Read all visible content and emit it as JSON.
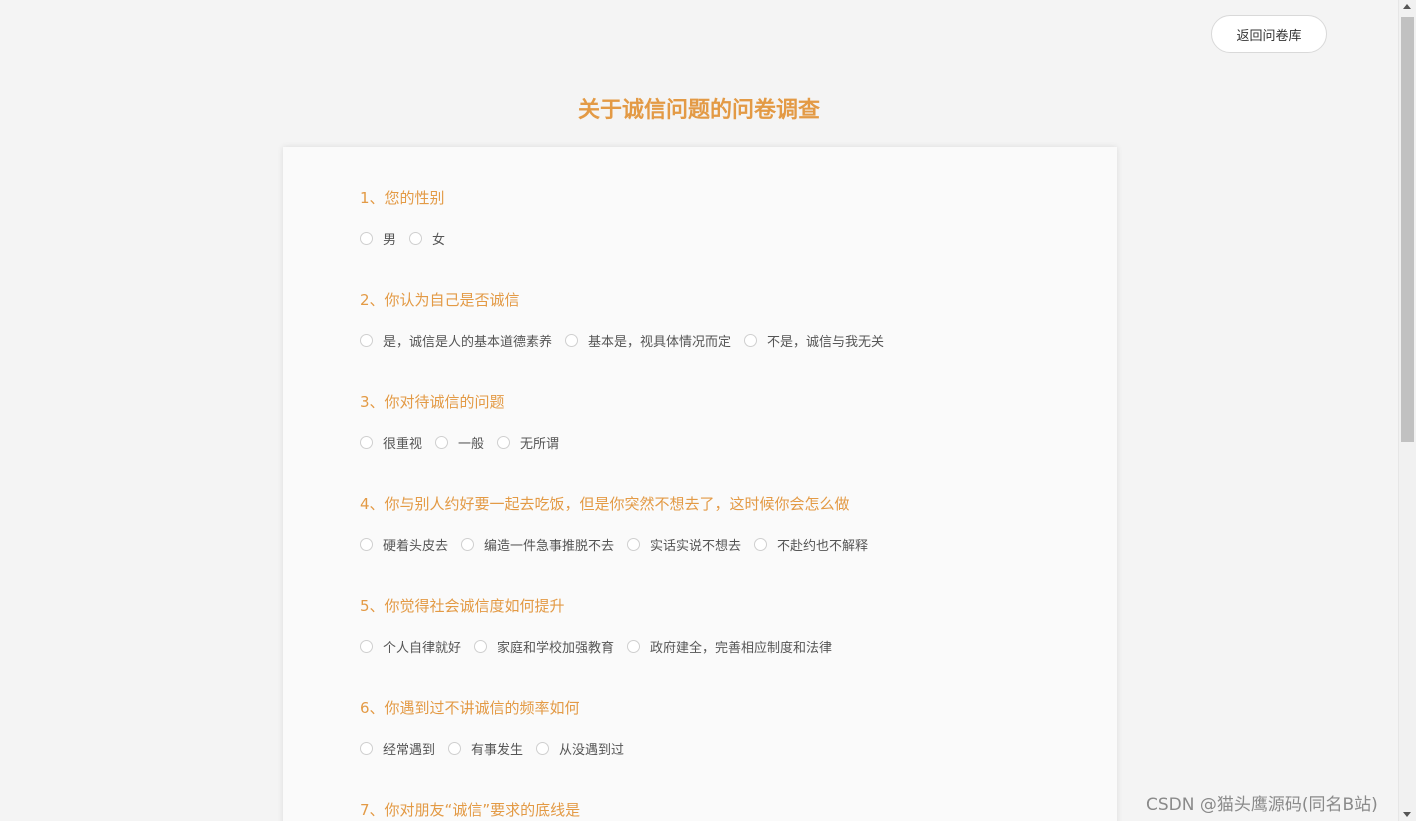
{
  "header": {
    "back_button_label": "返回问卷库"
  },
  "survey": {
    "title": "关于诚信问题的问卷调查",
    "questions": [
      {
        "title": "1、您的性别",
        "options": [
          "男",
          "女"
        ]
      },
      {
        "title": "2、你认为自己是否诚信",
        "options": [
          "是，诚信是人的基本道德素养",
          "基本是，视具体情况而定",
          "不是，诚信与我无关"
        ]
      },
      {
        "title": "3、你对待诚信的问题",
        "options": [
          "很重视",
          "一般",
          "无所谓"
        ]
      },
      {
        "title": "4、你与别人约好要一起去吃饭，但是你突然不想去了，这时候你会怎么做",
        "options": [
          "硬着头皮去",
          "编造一件急事推脱不去",
          "实话实说不想去",
          "不赴约也不解释"
        ]
      },
      {
        "title": "5、你觉得社会诚信度如何提升",
        "options": [
          "个人自律就好",
          "家庭和学校加强教育",
          "政府建全，完善相应制度和法律"
        ]
      },
      {
        "title": "6、你遇到过不讲诚信的频率如何",
        "options": [
          "经常遇到",
          "有事发生",
          "从没遇到过"
        ]
      },
      {
        "title": "7、你对朋友“诚信”要求的底线是",
        "options": []
      }
    ]
  },
  "watermark": "CSDN @猫头鹰源码(同名B站)",
  "colors": {
    "accent": "#e39a45",
    "background": "#f4f4f4",
    "card": "#fafafa"
  }
}
